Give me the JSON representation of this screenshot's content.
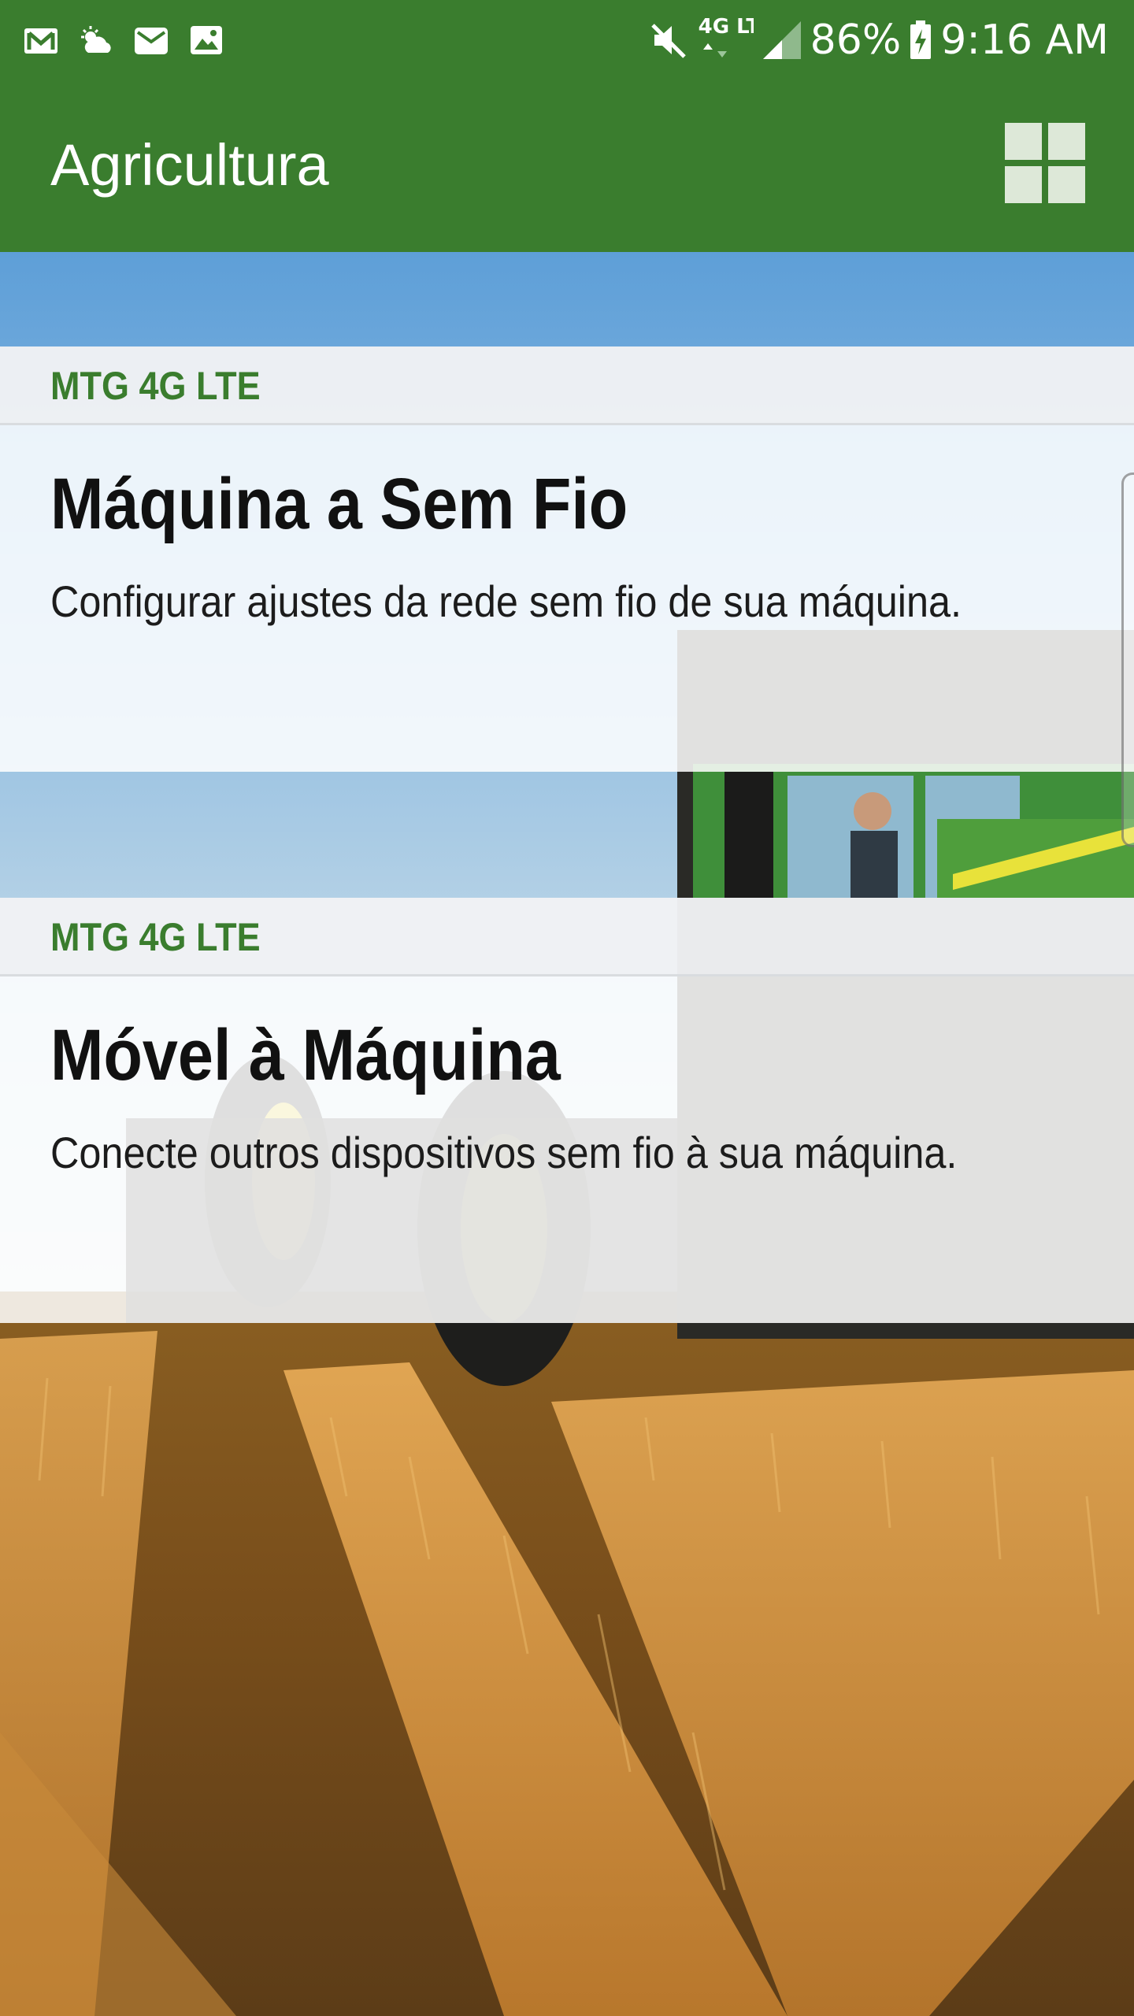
{
  "status_bar": {
    "network": "4G LTE",
    "battery": "86%",
    "time": "9:16 AM",
    "left_icons": [
      "gmail-icon",
      "weather-icon",
      "email-icon",
      "gallery-icon"
    ],
    "right_icons": [
      "mute-icon",
      "lte-icon",
      "signal-icon",
      "battery-charging-icon"
    ]
  },
  "app_bar": {
    "title": "Agricultura",
    "menu_icon": "grid-icon"
  },
  "cards": [
    {
      "label": "MTG 4G LTE",
      "title": "Máquina a Sem Fio",
      "description": "Configurar ajustes da rede sem fio de sua máquina."
    },
    {
      "label": "MTG 4G LTE",
      "title": "Móvel à Máquina",
      "description": "Conecte outros dispositivos sem fio à sua máquina."
    }
  ],
  "colors": {
    "brand_green": "#3a7d2e",
    "header_bg": "#f1f2f4",
    "title_text": "#111111",
    "accent_yellow": "#f2d21a"
  }
}
